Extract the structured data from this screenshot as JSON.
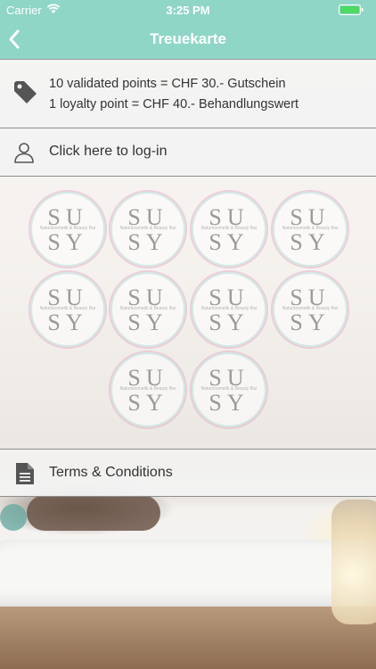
{
  "statusbar": {
    "carrier": "Carrier",
    "time": "3:25 PM"
  },
  "navbar": {
    "title": "Treuekarte"
  },
  "points": {
    "line1": "10 validated points = CHF 30.- Gutschein",
    "line2": "1 loyalty point = CHF 40.- Behandlungswert"
  },
  "login": {
    "label": "Click here to log-in"
  },
  "stamp": {
    "line1": "SU",
    "line2": "SY",
    "subtitle": "Naturkosmetik & Beauty Bar"
  },
  "terms": {
    "label": "Terms & Conditions"
  },
  "colors": {
    "accent": "#8fd6c7",
    "row_bg": "#f4f4f4"
  },
  "stamp_count": 10
}
